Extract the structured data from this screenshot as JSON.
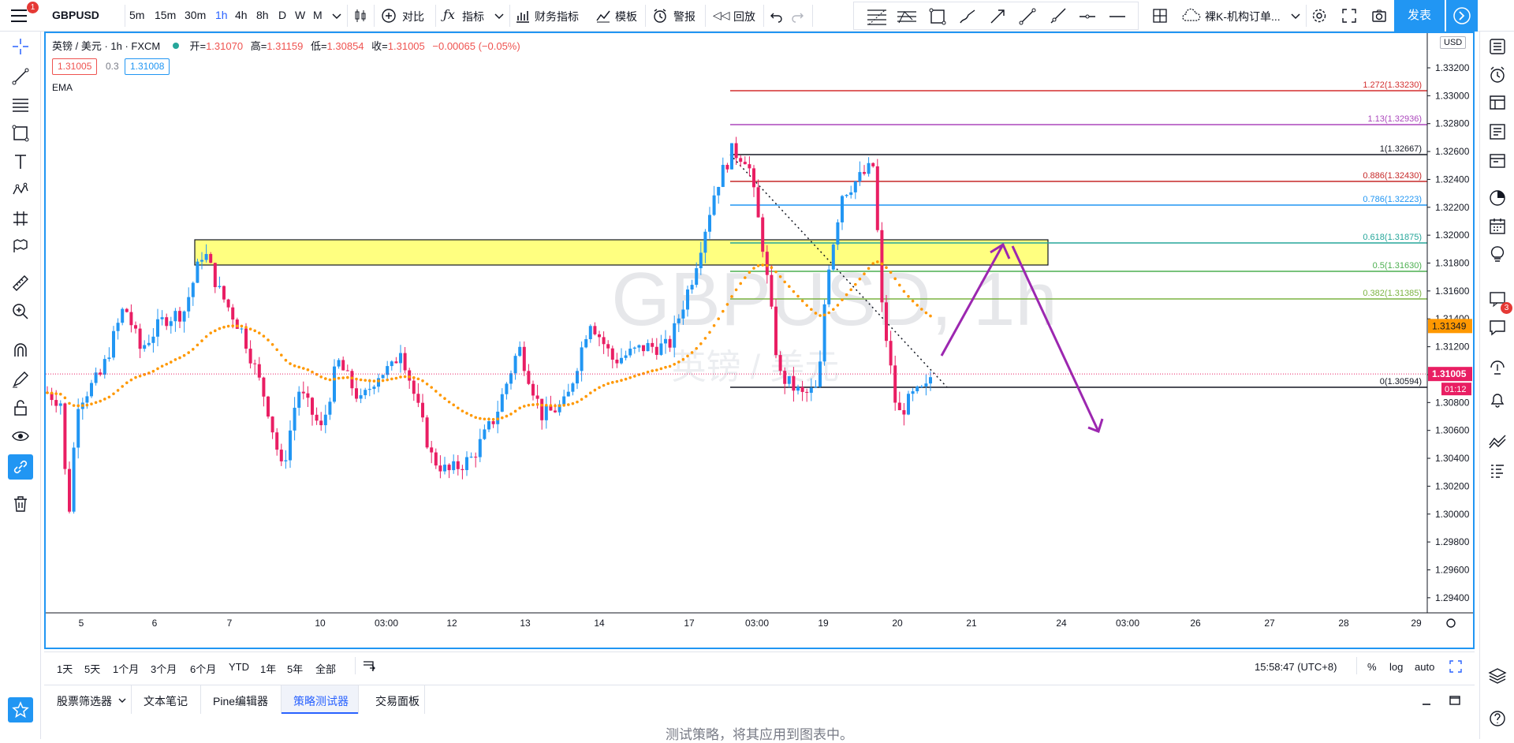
{
  "topbar": {
    "menu_badge": "1",
    "symbol": "GBPUSD",
    "timeframes": [
      "5m",
      "15m",
      "30m",
      "1h",
      "4h",
      "8h",
      "D",
      "W",
      "M"
    ],
    "active_timeframe": "1h",
    "compare_label": "对比",
    "indicators_label": "指标",
    "financials_label": "财务指标",
    "templates_label": "模板",
    "alert_label": "警报",
    "replay_label": "回放",
    "layout_name": "裸K-机构订单...",
    "publish_label": "发表"
  },
  "legend": {
    "name": "英镑 / 美元 · 1h · FXCM",
    "open_label": "开=",
    "open": "1.31070",
    "high_label": "高=",
    "high": "1.31159",
    "low_label": "低=",
    "low": "1.30854",
    "close_label": "收=",
    "close": "1.31005",
    "change": "−0.00065 (−0.05%)",
    "bid": "1.31005",
    "spread": "0.3",
    "ask": "1.31008",
    "indicator": "EMA"
  },
  "watermark": {
    "line1": "GBPUSD, 1h",
    "line2": "英镑 / 美元"
  },
  "price_axis": {
    "currency": "USD",
    "labels": [
      "1.33200",
      "1.33000",
      "1.32800",
      "1.32600",
      "1.32400",
      "1.32200",
      "1.32000",
      "1.31800",
      "1.31600",
      "1.31400",
      "1.31200",
      "1.31000",
      "1.30800",
      "1.30600",
      "1.30400",
      "1.30200",
      "1.30000",
      "1.29800",
      "1.29600",
      "1.29400"
    ],
    "ema_tag": "1.31349",
    "price_tag": "1.31005",
    "countdown": "01:12"
  },
  "time_axis": {
    "labels": [
      "5",
      "6",
      "7",
      "10",
      "03:00",
      "12",
      "13",
      "14",
      "17",
      "03:00",
      "19",
      "20",
      "21",
      "24",
      "03:00",
      "26",
      "27",
      "28",
      "29"
    ]
  },
  "fib_levels": [
    {
      "label": "1.272(1.33230)",
      "color": "#d32f2f"
    },
    {
      "label": "1.13(1.32936)",
      "color": "#ab47bc"
    },
    {
      "label": "1(1.32667)",
      "color": "#131722"
    },
    {
      "label": "0.886(1.32430)",
      "color": "#c62828"
    },
    {
      "label": "0.786(1.32223)",
      "color": "#2196f3"
    },
    {
      "label": "0.618(1.31875)",
      "color": "#26a69a"
    },
    {
      "label": "0.5(1.31630)",
      "color": "#4caf50"
    },
    {
      "label": "0.382(1.31385)",
      "color": "#7cb342"
    },
    {
      "label": "0(1.30594)",
      "color": "#131722"
    }
  ],
  "colors": {
    "accent": "#2196f3",
    "up_candle": "#2196f3",
    "down_candle": "#e91e63",
    "ema": "#ff9800",
    "zone_fill": "#ffff80",
    "arrow": "#9c27b0"
  },
  "rangebar": {
    "ranges": [
      "1天",
      "5天",
      "1个月",
      "3个月",
      "6个月",
      "YTD",
      "1年",
      "5年",
      "全部"
    ],
    "clock": "15:58:47 (UTC+8)",
    "percent": "%",
    "log": "log",
    "auto": "auto"
  },
  "bottom_panel": {
    "tabs": [
      "股票筛选器",
      "文本笔记",
      "Pine编辑器",
      "策略测试器",
      "交易面板"
    ],
    "active_tab": "策略测试器",
    "message": "测试策略，将其应用到图表中。"
  },
  "right_sidebar": {
    "chat_badge": "3"
  }
}
